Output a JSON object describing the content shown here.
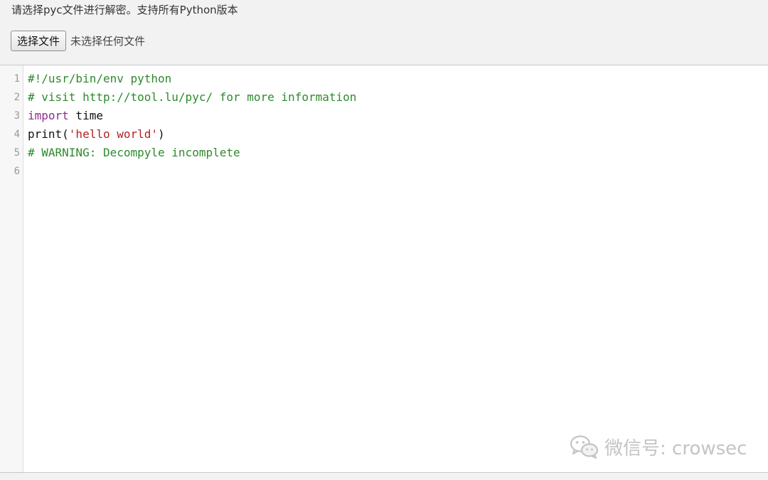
{
  "header": {
    "instruction": "请选择pyc文件进行解密。支持所有Python版本"
  },
  "file_input": {
    "button_label": "选择文件",
    "status": "未选择任何文件"
  },
  "editor": {
    "lines": [
      {
        "num": "1",
        "tokens": [
          {
            "type": "comment",
            "text": "#!/usr/bin/env python"
          }
        ]
      },
      {
        "num": "2",
        "tokens": [
          {
            "type": "comment",
            "text": "# visit http://tool.lu/pyc/ for more information"
          }
        ]
      },
      {
        "num": "3",
        "tokens": [
          {
            "type": "keyword",
            "text": "import"
          },
          {
            "type": "plain",
            "text": " time"
          }
        ]
      },
      {
        "num": "4",
        "tokens": [
          {
            "type": "plain",
            "text": "print("
          },
          {
            "type": "string",
            "text": "'hello world'"
          },
          {
            "type": "plain",
            "text": ")"
          }
        ]
      },
      {
        "num": "5",
        "tokens": [
          {
            "type": "comment",
            "text": "# WARNING: Decompyle incomplete"
          }
        ]
      },
      {
        "num": "6",
        "tokens": []
      }
    ],
    "colors": {
      "comment": "#2d8a2d",
      "keyword": "#8e2c8e",
      "string": "#b22222"
    }
  },
  "watermark": {
    "icon": "wechat-icon",
    "text": "微信号: crowsec"
  }
}
